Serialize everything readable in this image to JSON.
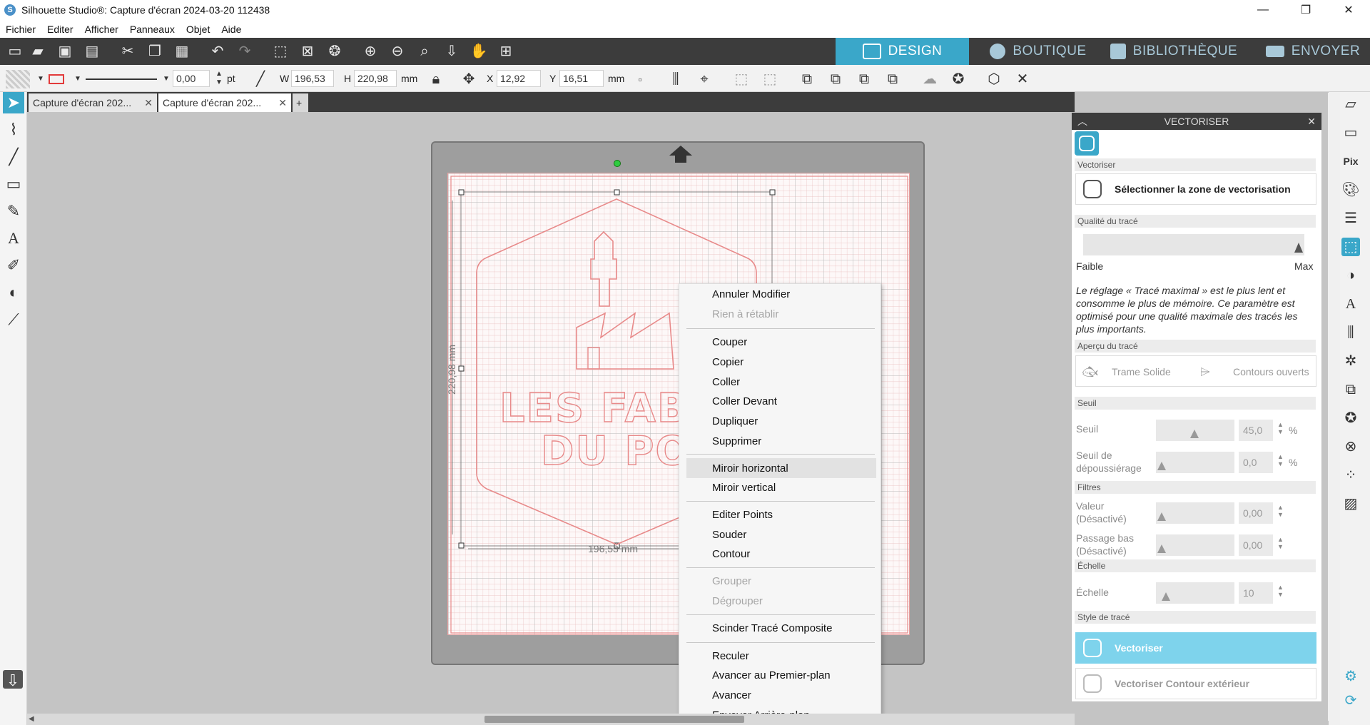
{
  "window": {
    "title": "Silhouette Studio®: Capture d'écran 2024-03-20 112438",
    "controls": {
      "minimize": "—",
      "maximize": "❐",
      "close": "✕"
    }
  },
  "menubar": [
    "Fichier",
    "Editer",
    "Afficher",
    "Panneaux",
    "Objet",
    "Aide"
  ],
  "navtabs": [
    {
      "label": "DESIGN",
      "active": true
    },
    {
      "label": "BOUTIQUE",
      "active": false
    },
    {
      "label": "BIBLIOTHÈQUE",
      "active": false
    },
    {
      "label": "ENVOYER",
      "active": false
    }
  ],
  "toolbar2": {
    "line_width": "0,00",
    "line_unit": "pt",
    "w_label": "W",
    "w_value": "196,53",
    "h_label": "H",
    "h_value": "220,98",
    "size_unit": "mm",
    "x_label": "X",
    "x_value": "12,92",
    "y_label": "Y",
    "y_value": "16,51",
    "pos_unit": "mm"
  },
  "doctabs": [
    {
      "label": "Capture d'écran 202...",
      "close": "✕"
    },
    {
      "label": "Capture d'écran 202...",
      "close": "✕"
    }
  ],
  "doctab_add": "+",
  "canvas": {
    "height_dim": "220,98 mm",
    "width_dim": "196,53 mm",
    "design_text_line1": "LES FABRIQ",
    "design_text_line2": "DU PONA"
  },
  "context_menu": [
    {
      "label": "Annuler Modifier",
      "enabled": true
    },
    {
      "label": "Rien à rétablir",
      "enabled": false
    },
    {
      "label": "Couper",
      "enabled": true
    },
    {
      "label": "Copier",
      "enabled": true
    },
    {
      "label": "Coller",
      "enabled": true
    },
    {
      "label": "Coller Devant",
      "enabled": true
    },
    {
      "label": "Dupliquer",
      "enabled": true
    },
    {
      "label": "Supprimer",
      "enabled": true
    },
    {
      "label": "Miroir horizontal",
      "enabled": true,
      "hovered": true
    },
    {
      "label": "Miroir vertical",
      "enabled": true
    },
    {
      "label": "Editer Points",
      "enabled": true
    },
    {
      "label": "Souder",
      "enabled": true
    },
    {
      "label": "Contour",
      "enabled": true
    },
    {
      "label": "Grouper",
      "enabled": false
    },
    {
      "label": "Dégrouper",
      "enabled": false
    },
    {
      "label": "Scinder Tracé Composite",
      "enabled": true
    },
    {
      "label": "Reculer",
      "enabled": true
    },
    {
      "label": "Avancer au Premier-plan",
      "enabled": true
    },
    {
      "label": "Avancer",
      "enabled": true
    },
    {
      "label": "Envoyer Arrière-plan",
      "enabled": true
    }
  ],
  "panel": {
    "title": "VECTORISER",
    "close": "✕",
    "collapse": "︿",
    "section_vectoriser": "Vectoriser",
    "select_area_button": "Sélectionner la zone de vectorisation",
    "section_quality": "Qualité du tracé",
    "quality_low": "Faible",
    "quality_high": "Max",
    "quality_level": 1.0,
    "quality_note": "Le réglage « Tracé maximal » est le plus lent et consomme le plus de mémoire. Ce paramètre est optimisé pour une qualité maximale des tracés les plus importants.",
    "section_preview": "Aperçu du tracé",
    "preview_solid": "Trame Solide",
    "preview_open": "Contours ouverts",
    "section_threshold": "Seuil",
    "threshold_label": "Seuil",
    "threshold_value": "45,0",
    "threshold_unit": "%",
    "despeckle_label_1": "Seuil de",
    "despeckle_label_2": "dépoussiérage",
    "despeckle_value": "0,0",
    "despeckle_unit": "%",
    "section_filters": "Filtres",
    "value_label_1": "Valeur",
    "value_label_2": "(Désactivé)",
    "value_value": "0,00",
    "lowpass_label_1": "Passage bas",
    "lowpass_label_2": "(Désactivé)",
    "lowpass_value": "0,00",
    "section_scale": "Échelle",
    "scale_label": "Échelle",
    "scale_value": "10",
    "section_style": "Style de tracé",
    "trace_button": "Vectoriser",
    "trace_outer_button": "Vectoriser Contour extérieur"
  },
  "colors": {
    "accent": "#3aa7c9",
    "toolbar_dark": "#3c3c3c",
    "cut_line": "#e88a8a"
  }
}
